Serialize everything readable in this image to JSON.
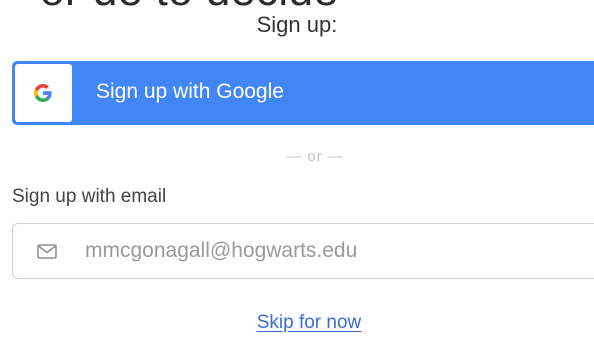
{
  "header": {
    "partial_heading": "or de to decide"
  },
  "signup": {
    "title": "Sign up:",
    "google_button_label": "Sign up with Google",
    "google_logo_letter": "G",
    "divider_text": "— or —",
    "email_section_label": "Sign up with email",
    "email_placeholder": "mmcgonagall@hogwarts.edu",
    "skip_link": "Skip for now"
  },
  "icons": {
    "google": "google-g-icon",
    "email": "envelope-icon"
  },
  "colors": {
    "google_blue": "#4285f4",
    "link_blue": "#3d6bd6",
    "divider_gray": "#c4c4c4"
  }
}
